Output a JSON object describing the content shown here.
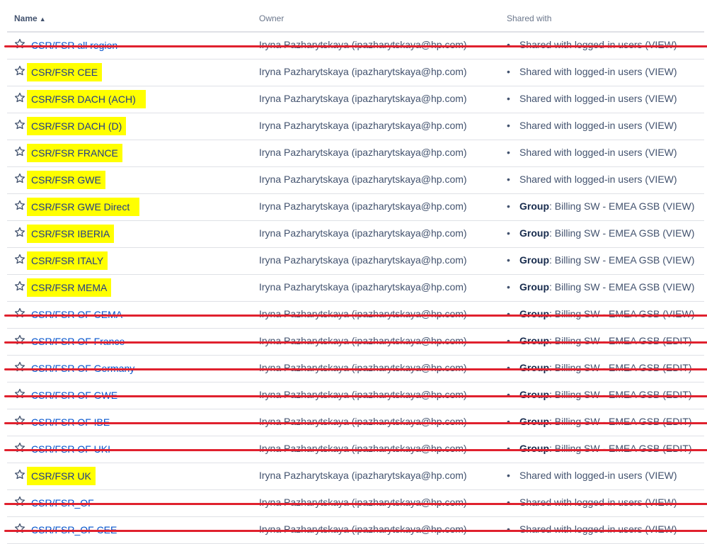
{
  "header": {
    "name": "Name",
    "owner": "Owner",
    "shared": "Shared with"
  },
  "rows": [
    {
      "name": "CSR/FSR all region",
      "owner": "Iryna Pazharytskaya (ipazharytskaya@hp.com)",
      "shared_prefix": "",
      "shared": "Shared with logged-in users (VIEW)"
    },
    {
      "name": "CSR/FSR CEE",
      "owner": "Iryna Pazharytskaya (ipazharytskaya@hp.com)",
      "shared_prefix": "",
      "shared": "Shared with logged-in users (VIEW)"
    },
    {
      "name": "CSR/FSR DACH (ACH)",
      "owner": "Iryna Pazharytskaya (ipazharytskaya@hp.com)",
      "shared_prefix": "",
      "shared": "Shared with logged-in users (VIEW)"
    },
    {
      "name": "CSR/FSR DACH (D)",
      "owner": "Iryna Pazharytskaya (ipazharytskaya@hp.com)",
      "shared_prefix": "",
      "shared": "Shared with logged-in users (VIEW)"
    },
    {
      "name": "CSR/FSR FRANCE",
      "owner": "Iryna Pazharytskaya (ipazharytskaya@hp.com)",
      "shared_prefix": "",
      "shared": "Shared with logged-in users (VIEW)"
    },
    {
      "name": "CSR/FSR GWE",
      "owner": "Iryna Pazharytskaya (ipazharytskaya@hp.com)",
      "shared_prefix": "",
      "shared": "Shared with logged-in users (VIEW)"
    },
    {
      "name": "CSR/FSR GWE Direct",
      "owner": "Iryna Pazharytskaya (ipazharytskaya@hp.com)",
      "shared_prefix": "Group",
      "shared": ": Billing SW - EMEA GSB (VIEW)"
    },
    {
      "name": "CSR/FSR IBERIA",
      "owner": "Iryna Pazharytskaya (ipazharytskaya@hp.com)",
      "shared_prefix": "Group",
      "shared": ": Billing SW - EMEA GSB (VIEW)"
    },
    {
      "name": "CSR/FSR ITALY",
      "owner": "Iryna Pazharytskaya (ipazharytskaya@hp.com)",
      "shared_prefix": "Group",
      "shared": ": Billing SW - EMEA GSB (VIEW)"
    },
    {
      "name": "CSR/FSR MEMA",
      "owner": "Iryna Pazharytskaya (ipazharytskaya@hp.com)",
      "shared_prefix": "Group",
      "shared": ": Billing SW - EMEA GSB (VIEW)"
    },
    {
      "name": "CSR/FSR OF CEMA",
      "owner": "Iryna Pazharytskaya (ipazharytskaya@hp.com)",
      "shared_prefix": "Group",
      "shared": ": Billing SW - EMEA GSB (VIEW)"
    },
    {
      "name": "CSR/FSR OF France",
      "owner": "Iryna Pazharytskaya (ipazharytskaya@hp.com)",
      "shared_prefix": "Group",
      "shared": ": Billing SW - EMEA GSB (EDIT)"
    },
    {
      "name": "CSR/FSR OF Germany",
      "owner": "Iryna Pazharytskaya (ipazharytskaya@hp.com)",
      "shared_prefix": "Group",
      "shared": ": Billing SW - EMEA GSB (EDIT)"
    },
    {
      "name": "CSR/FSR OF GWE",
      "owner": "Iryna Pazharytskaya (ipazharytskaya@hp.com)",
      "shared_prefix": "Group",
      "shared": ": Billing SW - EMEA GSB (EDIT)"
    },
    {
      "name": "CSR/FSR OF IBE",
      "owner": "Iryna Pazharytskaya (ipazharytskaya@hp.com)",
      "shared_prefix": "Group",
      "shared": ": Billing SW - EMEA GSB (EDIT)"
    },
    {
      "name": "CSR/FSR OF UKI",
      "owner": "Iryna Pazharytskaya (ipazharytskaya@hp.com)",
      "shared_prefix": "Group",
      "shared": ": Billing SW - EMEA GSB (EDIT)"
    },
    {
      "name": "CSR/FSR UK",
      "owner": "Iryna Pazharytskaya (ipazharytskaya@hp.com)",
      "shared_prefix": "",
      "shared": "Shared with logged-in users (VIEW)"
    },
    {
      "name": "CSR/FSR_OF",
      "owner": "Iryna Pazharytskaya (ipazharytskaya@hp.com)",
      "shared_prefix": "",
      "shared": "Shared with logged-in users (VIEW)"
    },
    {
      "name": "CSR/FSR_OF CEE",
      "owner": "Iryna Pazharytskaya (ipazharytskaya@hp.com)",
      "shared_prefix": "",
      "shared": "Shared with logged-in users (VIEW)"
    }
  ],
  "colors": {
    "highlight": "#ffff00",
    "strike": "#e0212e",
    "link": "#0052cc"
  },
  "icons": {
    "favourite": "star-outline-icon",
    "sort": "sort-ascending-icon"
  }
}
